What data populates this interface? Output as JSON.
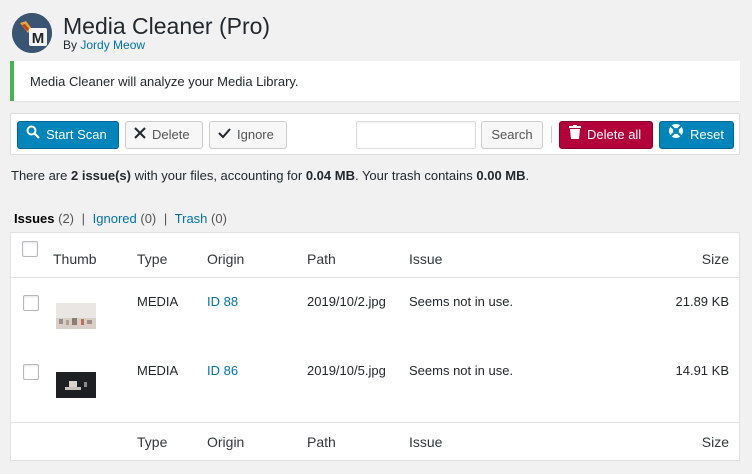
{
  "header": {
    "title": "Media Cleaner (Pro)",
    "by_prefix": "By",
    "author": "Jordy Meow",
    "logo_letter": "M"
  },
  "notice": {
    "text": "Media Cleaner will analyze your Media Library."
  },
  "toolbar": {
    "start_scan_label": "Start Scan",
    "delete_label": "Delete",
    "ignore_label": "Ignore",
    "search_value": "",
    "search_label": "Search",
    "delete_all_label": "Delete all",
    "reset_label": "Reset"
  },
  "summary": {
    "part1": "There are ",
    "issues": "2 issue(s)",
    "part2": " with your files, accounting for ",
    "size": "0.04 MB",
    "part3": ". Your trash contains ",
    "trash": "0.00 MB",
    "part4": "."
  },
  "filters": {
    "issues_label": "Issues",
    "issues_count": "(2)",
    "ignored_label": "Ignored",
    "ignored_count": "(0)",
    "trash_label": "Trash",
    "trash_count": "(0)",
    "separator": "|"
  },
  "table": {
    "columns": [
      "Thumb",
      "Type",
      "Origin",
      "Path",
      "Issue",
      "Size"
    ],
    "footer_columns": [
      "Type",
      "Origin",
      "Path",
      "Issue",
      "Size"
    ],
    "rows": [
      {
        "type": "MEDIA",
        "origin": "ID 88",
        "path": "2019/10/2.jpg",
        "issue": "Seems not in use.",
        "size": "21.89 KB"
      },
      {
        "type": "MEDIA",
        "origin": "ID 86",
        "path": "2019/10/5.jpg",
        "issue": "Seems not in use.",
        "size": "14.91 KB"
      }
    ]
  },
  "colors": {
    "primary": "#0085ba",
    "danger": "#b3003a",
    "link": "#0073aa",
    "notice_border": "#46b450"
  },
  "icons": {
    "start_scan": "search-icon",
    "delete": "close-icon",
    "ignore": "checkmark-icon",
    "delete_all": "trash-icon",
    "reset": "lifebuoy-icon"
  }
}
